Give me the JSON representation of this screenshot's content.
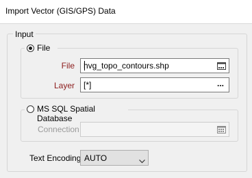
{
  "window": {
    "title": "Import Vector (GIS/GPS) Data"
  },
  "input_group": {
    "label": "Input"
  },
  "file_source": {
    "radio_label": "File",
    "selected": true,
    "file": {
      "label": "File",
      "value": "hvg_topo_contours.shp",
      "button_icon": "browse-file-icon"
    },
    "layer": {
      "label": "Layer",
      "value": "[*]",
      "button_label": "..."
    }
  },
  "sql_source": {
    "radio_label": "MS SQL Spatial Database",
    "selected": false,
    "connection": {
      "label": "Connection",
      "value": "",
      "button_icon": "database-connection-icon"
    }
  },
  "encoding": {
    "label": "Text Encoding",
    "value": "AUTO",
    "icon": "chevron-down-icon"
  },
  "colors": {
    "required_label": "#8b1a1a",
    "disabled_label": "#9a9a9a"
  }
}
